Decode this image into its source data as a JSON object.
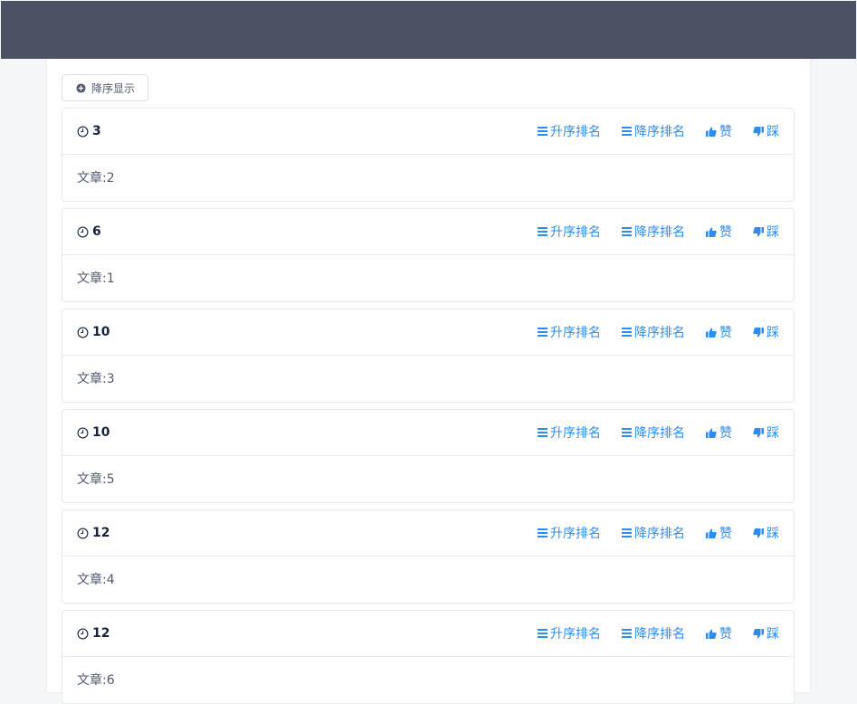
{
  "sort_button": {
    "label": "降序显示",
    "icon": "plus-circle-icon"
  },
  "actions": {
    "asc_label": "升序排名",
    "desc_label": "降序排名",
    "like_label": "赞",
    "dislike_label": "踩"
  },
  "colors": {
    "header": "#4b5263",
    "link": "#2d8cf0",
    "title": "#17233d"
  },
  "cards": [
    {
      "title": "3",
      "content": "文章:2"
    },
    {
      "title": "6",
      "content": "文章:1"
    },
    {
      "title": "10",
      "content": "文章:3"
    },
    {
      "title": "10",
      "content": "文章:5"
    },
    {
      "title": "12",
      "content": "文章:4"
    },
    {
      "title": "12",
      "content": "文章:6"
    }
  ]
}
